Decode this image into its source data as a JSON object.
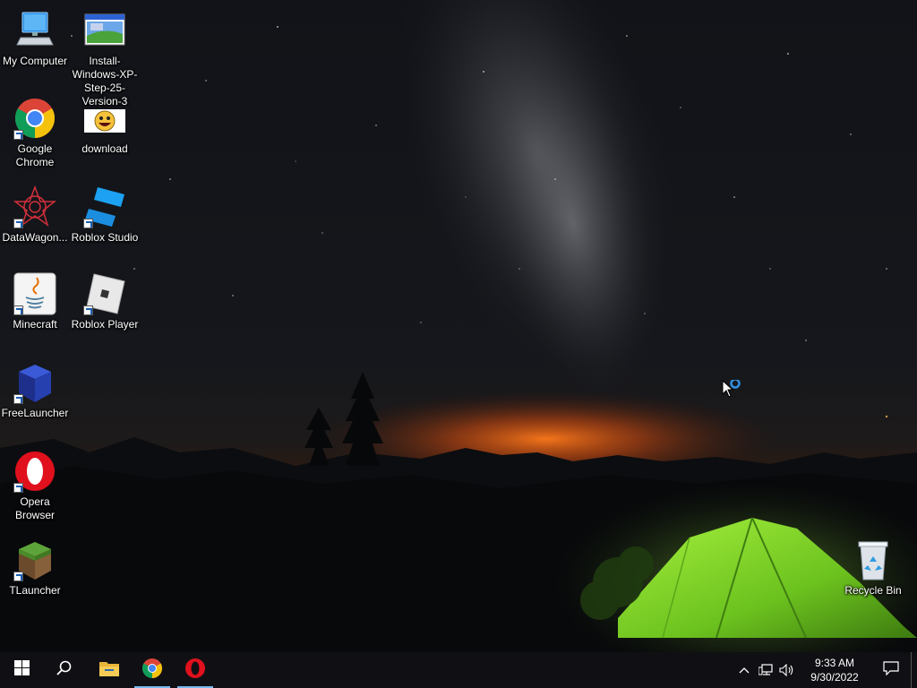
{
  "desktop": {
    "icons": [
      {
        "label": "My Computer",
        "icon": "computer-icon"
      },
      {
        "label": "Install-Windows-XP-Step-25-Version-3",
        "icon": "xp-installer-icon"
      },
      {
        "label": "Google Chrome",
        "icon": "chrome-icon"
      },
      {
        "label": "download",
        "icon": "download-emoji-icon"
      },
      {
        "label": "DataWagon...",
        "icon": "datawagon-icon"
      },
      {
        "label": "Roblox Studio",
        "icon": "roblox-studio-icon"
      },
      {
        "label": "Minecraft",
        "icon": "java-icon"
      },
      {
        "label": "Roblox Player",
        "icon": "roblox-player-icon"
      },
      {
        "label": "FreeLauncher",
        "icon": "freelauncher-icon"
      },
      {
        "label": "Opera Browser",
        "icon": "opera-icon"
      },
      {
        "label": "TLauncher",
        "icon": "tlauncher-icon"
      },
      {
        "label": "Recycle Bin",
        "icon": "recycle-bin-icon"
      }
    ]
  },
  "taskbar": {
    "pinned": [
      {
        "name": "start",
        "icon": "windows-logo-icon"
      },
      {
        "name": "search",
        "icon": "search-icon"
      },
      {
        "name": "file-explorer",
        "icon": "folder-icon"
      },
      {
        "name": "chrome",
        "icon": "chrome-icon"
      },
      {
        "name": "opera",
        "icon": "opera-icon"
      }
    ],
    "tray": {
      "time": "9:33 AM",
      "date": "9/30/2022"
    }
  },
  "colors": {
    "taskbar_bg": "#101014",
    "active_indicator": "#76b9ed",
    "tent_green": "#7bd12a"
  }
}
